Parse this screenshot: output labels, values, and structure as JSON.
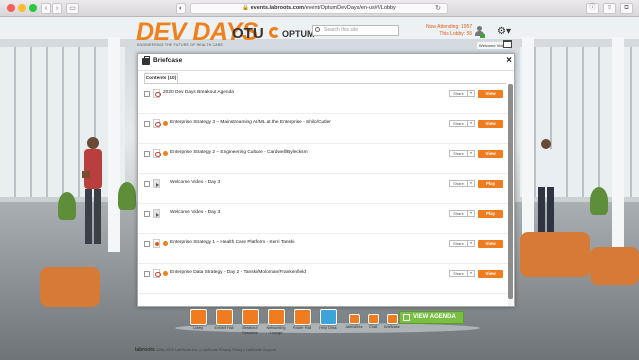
{
  "browser": {
    "url_domain": "events.labroots.com",
    "url_path": "/event/OptumDevDays/en-us#!/Lobby",
    "back_glyph": "‹",
    "forward_glyph": "›",
    "sidebar_glyph": "▭"
  },
  "header": {
    "logo_main": "DEV DAYS",
    "logo_tagline": "ENGINEERING THE FUTURE OF HEALTH CARE",
    "logo_otu": "OTU",
    "logo_optum": "OPTUM",
    "search_placeholder": "Search this site",
    "attending_line1": "Now Attending: 1957",
    "attending_line2": "This Lobby: 55",
    "settings_glyph": "⚙▾",
    "welcome_video": "Welcome Video"
  },
  "briefcase": {
    "title": "Briefcase",
    "close_glyph": "×",
    "tab_label": "Contents (10)",
    "share_label": "Share",
    "dropdown_glyph": "▾",
    "items": [
      {
        "title": "2020 Dev Days Breakout Agenda",
        "file": "pdf",
        "action": "View",
        "viewed": false
      },
      {
        "title": "Enterprise Strategy 3 – Mainstreaming AI/ML at the Enterprise - Shilo/Cutler",
        "file": "pdf",
        "action": "View",
        "viewed": true
      },
      {
        "title": "Enterprise Strategy 2 – Engineering Culture - Cardwell/Bylecksm",
        "file": "pdf",
        "action": "View",
        "viewed": true
      },
      {
        "title": "Welcome Video - Day 3",
        "file": "video",
        "action": "Play",
        "viewed": false
      },
      {
        "title": "Welcome Video - Day 3",
        "file": "video",
        "action": "Play",
        "viewed": false
      },
      {
        "title": "Enterprise Strategy 1 – Health Care Platform - Kerri Tanski",
        "file": "ppt",
        "action": "View",
        "viewed": true
      },
      {
        "title": "Enterprise Data Strategy - Day 2 - Tanski/Moloman/Frankenfield",
        "file": "pdf",
        "action": "View",
        "viewed": true
      }
    ]
  },
  "nav": {
    "items": [
      {
        "label": "Lobby",
        "color": "orange"
      },
      {
        "label": "Exhibit Hall",
        "color": "orange"
      },
      {
        "label": "Breakout Sessions",
        "color": "orange"
      },
      {
        "label": "Networking Lounge",
        "color": "orange"
      },
      {
        "label": "Poster Hall",
        "color": "orange"
      },
      {
        "label": "Help Desk",
        "color": "blue"
      },
      {
        "label": "Attendees",
        "color": "orange"
      },
      {
        "label": "Chat",
        "color": "orange"
      },
      {
        "label": "Briefcase",
        "color": "orange"
      }
    ],
    "agenda_button": "VIEW AGENDA"
  },
  "footer": {
    "brand": "labroots",
    "text": "2006-2020 LabRoots Inc. | LabRoots Privacy Policy | LabRoots Support"
  },
  "colors": {
    "accent_orange": "#ef7d1f",
    "help_blue": "#3da3d9",
    "agenda_green": "#79bf43"
  }
}
